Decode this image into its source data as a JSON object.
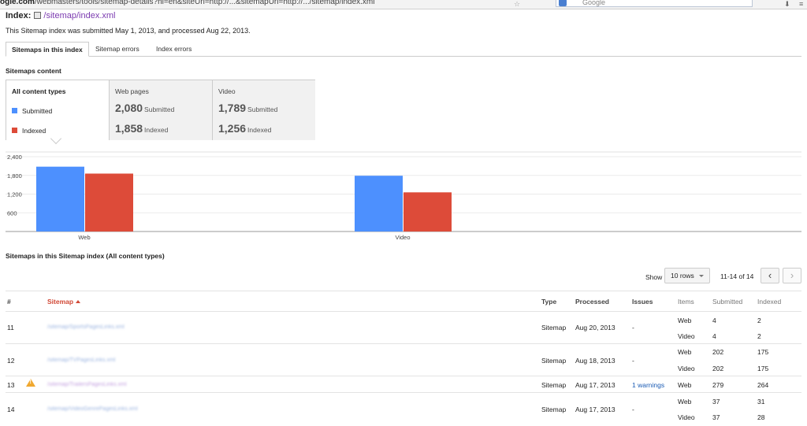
{
  "browser": {
    "url_host": "ogle.com",
    "url_path": "/webmasters/tools/sitemap-details?hl=en&siteUrl=http://...&sitemapUrl=http://.../sitemap/index.xml",
    "search_engine": "Google",
    "icons": [
      "bookmark-star-icon",
      "download-icon",
      "menu-icon"
    ]
  },
  "header": {
    "index_label": "Index:",
    "index_link": "/sitemap/index.xml",
    "subtitle": "This Sitemap index was submitted May 1, 2013, and processed Aug 22, 2013."
  },
  "tabs": [
    {
      "label": "Sitemaps in this index",
      "active": true
    },
    {
      "label": "Sitemap errors",
      "active": false
    },
    {
      "label": "Index errors",
      "active": false
    }
  ],
  "content": {
    "title": "Sitemaps content",
    "all_types": "All content types",
    "legend": [
      {
        "label": "Submitted",
        "color": "#4d90fe"
      },
      {
        "label": "Indexed",
        "color": "#dd4b39"
      }
    ],
    "columns": [
      {
        "name": "Web pages",
        "submitted": "2,080",
        "indexed": "1,858"
      },
      {
        "name": "Video",
        "submitted": "1,789",
        "indexed": "1,256"
      }
    ],
    "submitted_word": "Submitted",
    "indexed_word": "Indexed"
  },
  "chart_data": {
    "type": "bar",
    "categories": [
      "Web",
      "Video"
    ],
    "series": [
      {
        "name": "Submitted",
        "values": [
          2080,
          1789
        ],
        "color": "#4d90fe"
      },
      {
        "name": "Indexed",
        "values": [
          1858,
          1256
        ],
        "color": "#dd4b39"
      }
    ],
    "yticks": [
      "600",
      "1,200",
      "1,800",
      "2,400"
    ],
    "ytick_values": [
      600,
      1200,
      1800,
      2400
    ],
    "ylim": [
      0,
      2400
    ],
    "grid": true,
    "title": "",
    "xlabel": "",
    "ylabel": ""
  },
  "table": {
    "title": "Sitemaps in this Sitemap index (All content types)",
    "show_label": "Show",
    "rows_option": "10 rows",
    "pager": "11-14 of 14",
    "headers": {
      "num": "#",
      "sitemap": "Sitemap",
      "type": "Type",
      "processed": "Processed",
      "issues": "Issues",
      "items": "Items",
      "submitted": "Submitted",
      "indexed": "Indexed"
    },
    "rows": [
      {
        "num": "11",
        "sitemap": "/sitemap/SportsPagesLinks.xml",
        "visited": false,
        "warning": false,
        "type": "Sitemap",
        "processed": "Aug 20, 2013",
        "issues": "-",
        "items": [
          {
            "item": "Web",
            "submitted": "4",
            "indexed": "2"
          },
          {
            "item": "Video",
            "submitted": "4",
            "indexed": "2"
          }
        ]
      },
      {
        "num": "12",
        "sitemap": "/sitemap/TVPagesLinks.xml",
        "visited": false,
        "warning": false,
        "type": "Sitemap",
        "processed": "Aug 18, 2013",
        "issues": "-",
        "items": [
          {
            "item": "Web",
            "submitted": "202",
            "indexed": "175"
          },
          {
            "item": "Video",
            "submitted": "202",
            "indexed": "175"
          }
        ]
      },
      {
        "num": "13",
        "sitemap": "/sitemap/TrailersPagesLinks.xml",
        "visited": true,
        "warning": true,
        "type": "Sitemap",
        "processed": "Aug 17, 2013",
        "issues": "1 warnings",
        "items": [
          {
            "item": "Web",
            "submitted": "279",
            "indexed": "264"
          }
        ]
      },
      {
        "num": "14",
        "sitemap": "/sitemap/VideoGenrePagesLinks.xml",
        "visited": false,
        "warning": false,
        "type": "Sitemap",
        "processed": "Aug 17, 2013",
        "issues": "-",
        "items": [
          {
            "item": "Web",
            "submitted": "37",
            "indexed": "31"
          },
          {
            "item": "Video",
            "submitted": "37",
            "indexed": "28"
          }
        ]
      }
    ]
  }
}
